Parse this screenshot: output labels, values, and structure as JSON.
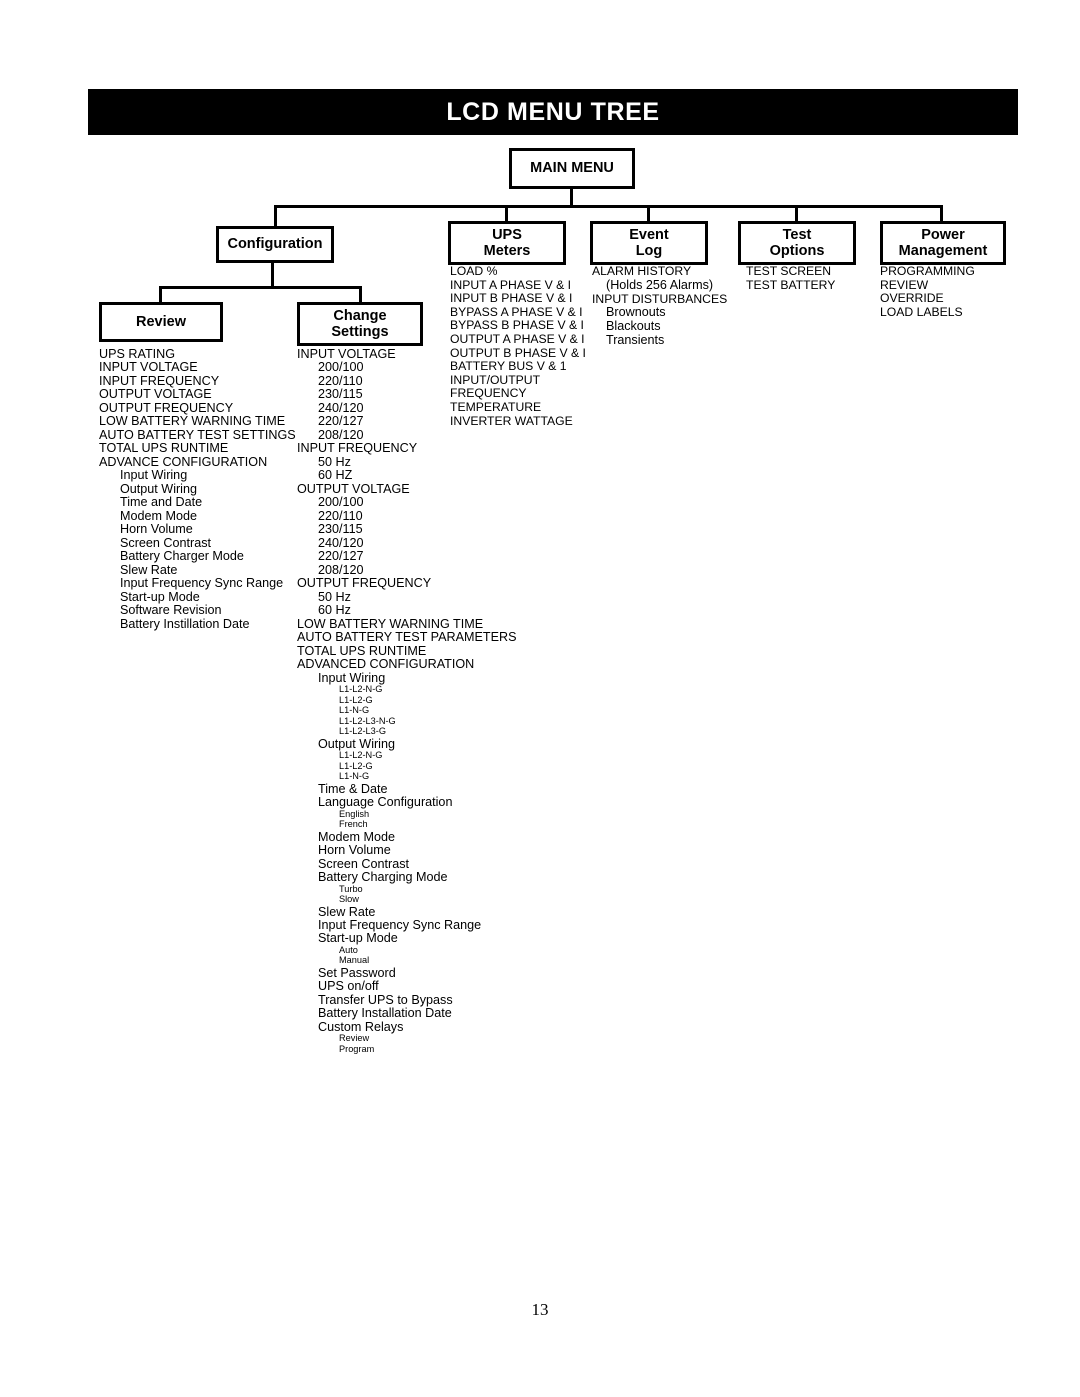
{
  "banner": {
    "title": "LCD MENU TREE",
    "background_color": "#000000",
    "text_color": "#FFFFFF"
  },
  "page_number": "13",
  "tree": {
    "root": {
      "label_line1": "MAIN MENU",
      "label_line2": ""
    },
    "top_level": [
      {
        "label_line1": "Configuration",
        "label_line2": ""
      },
      {
        "label_line1": "UPS",
        "label_line2": "Meters"
      },
      {
        "label_line1": "Event",
        "label_line2": "Log"
      },
      {
        "label_line1": "Test",
        "label_line2": "Options"
      },
      {
        "label_line1": "Power",
        "label_line2": "Management"
      }
    ],
    "configuration_children": [
      {
        "label_line1": "Review",
        "label_line2": ""
      },
      {
        "label_line1": "Change",
        "label_line2": "Settings"
      }
    ]
  },
  "lists": {
    "review": [
      {
        "level": 0,
        "text": "UPS RATING"
      },
      {
        "level": 0,
        "text": "INPUT VOLTAGE"
      },
      {
        "level": 0,
        "text": "INPUT FREQUENCY"
      },
      {
        "level": 0,
        "text": "OUTPUT VOLTAGE"
      },
      {
        "level": 0,
        "text": "OUTPUT FREQUENCY"
      },
      {
        "level": 0,
        "text": "LOW BATTERY WARNING TIME"
      },
      {
        "level": 0,
        "text": "AUTO BATTERY TEST SETTINGS"
      },
      {
        "level": 0,
        "text": "TOTAL UPS RUNTIME"
      },
      {
        "level": 0,
        "text": "ADVANCE CONFIGURATION"
      },
      {
        "level": 1,
        "text": "Input Wiring"
      },
      {
        "level": 1,
        "text": "Output Wiring"
      },
      {
        "level": 1,
        "text": "Time and Date"
      },
      {
        "level": 1,
        "text": "Modem Mode"
      },
      {
        "level": 1,
        "text": "Horn Volume"
      },
      {
        "level": 1,
        "text": "Screen Contrast"
      },
      {
        "level": 1,
        "text": "Battery Charger Mode"
      },
      {
        "level": 1,
        "text": "Slew Rate"
      },
      {
        "level": 1,
        "text": "Input Frequency Sync Range"
      },
      {
        "level": 1,
        "text": "Start-up Mode"
      },
      {
        "level": 1,
        "text": "Software Revision"
      },
      {
        "level": 1,
        "text": "Battery Instillation Date"
      }
    ],
    "change_settings": [
      {
        "level": 0,
        "text": "INPUT VOLTAGE"
      },
      {
        "level": 1,
        "text": "200/100"
      },
      {
        "level": 1,
        "text": "220/110"
      },
      {
        "level": 1,
        "text": "230/115"
      },
      {
        "level": 1,
        "text": "240/120"
      },
      {
        "level": 1,
        "text": "220/127"
      },
      {
        "level": 1,
        "text": "208/120"
      },
      {
        "level": 0,
        "text": "INPUT FREQUENCY"
      },
      {
        "level": 1,
        "text": "50 Hz"
      },
      {
        "level": 1,
        "text": "60 HZ"
      },
      {
        "level": 0,
        "text": "OUTPUT VOLTAGE"
      },
      {
        "level": 1,
        "text": "200/100"
      },
      {
        "level": 1,
        "text": "220/110"
      },
      {
        "level": 1,
        "text": "230/115"
      },
      {
        "level": 1,
        "text": "240/120"
      },
      {
        "level": 1,
        "text": "220/127"
      },
      {
        "level": 1,
        "text": "208/120"
      },
      {
        "level": 0,
        "text": "OUTPUT FREQUENCY"
      },
      {
        "level": 1,
        "text": "50 Hz"
      },
      {
        "level": 1,
        "text": "60 Hz"
      },
      {
        "level": 0,
        "text": "LOW BATTERY WARNING TIME"
      },
      {
        "level": 0,
        "text": "AUTO BATTERY TEST PARAMETERS"
      },
      {
        "level": 0,
        "text": "TOTAL UPS RUNTIME"
      },
      {
        "level": 0,
        "text": "ADVANCED CONFIGURATION"
      },
      {
        "level": 1,
        "text": "Input Wiring"
      },
      {
        "level": 2,
        "text": "L1-L2-N-G"
      },
      {
        "level": 2,
        "text": "L1-L2-G"
      },
      {
        "level": 2,
        "text": "L1-N-G"
      },
      {
        "level": 2,
        "text": "L1-L2-L3-N-G"
      },
      {
        "level": 2,
        "text": "L1-L2-L3-G"
      },
      {
        "level": 1,
        "text": "Output Wiring"
      },
      {
        "level": 2,
        "text": "L1-L2-N-G"
      },
      {
        "level": 2,
        "text": "L1-L2-G"
      },
      {
        "level": 2,
        "text": "L1-N-G"
      },
      {
        "level": 1,
        "text": "Time & Date"
      },
      {
        "level": 1,
        "text": "Language Configuration"
      },
      {
        "level": 2,
        "text": "English"
      },
      {
        "level": 2,
        "text": "French"
      },
      {
        "level": 1,
        "text": "Modem Mode"
      },
      {
        "level": 1,
        "text": "Horn Volume"
      },
      {
        "level": 1,
        "text": "Screen Contrast"
      },
      {
        "level": 1,
        "text": "Battery Charging Mode"
      },
      {
        "level": 2,
        "text": "Turbo"
      },
      {
        "level": 2,
        "text": "Slow"
      },
      {
        "level": 1,
        "text": "Slew Rate"
      },
      {
        "level": 1,
        "text": "Input Frequency Sync Range"
      },
      {
        "level": 1,
        "text": "Start-up Mode"
      },
      {
        "level": 2,
        "text": "Auto"
      },
      {
        "level": 2,
        "text": "Manual"
      },
      {
        "level": 1,
        "text": "Set Password"
      },
      {
        "level": 1,
        "text": "UPS on/off"
      },
      {
        "level": 1,
        "text": "Transfer UPS to Bypass"
      },
      {
        "level": 1,
        "text": "Battery Installation Date"
      },
      {
        "level": 1,
        "text": "Custom Relays"
      },
      {
        "level": 2,
        "text": "Review"
      },
      {
        "level": 2,
        "text": "Program"
      }
    ],
    "ups_meters": [
      {
        "level": 0,
        "text": "LOAD %"
      },
      {
        "level": 0,
        "text": "INPUT A PHASE V & I"
      },
      {
        "level": 0,
        "text": "INPUT B PHASE V & I"
      },
      {
        "level": 0,
        "text": "BYPASS A PHASE V & I"
      },
      {
        "level": 0,
        "text": "BYPASS B PHASE V & I"
      },
      {
        "level": 0,
        "text": "OUTPUT A PHASE V & I"
      },
      {
        "level": 0,
        "text": "OUTPUT B PHASE V & I"
      },
      {
        "level": 0,
        "text": "BATTERY BUS V & 1"
      },
      {
        "level": 0,
        "text": "INPUT/OUTPUT"
      },
      {
        "level": 0,
        "text": "FREQUENCY"
      },
      {
        "level": 0,
        "text": "TEMPERATURE"
      },
      {
        "level": 0,
        "text": "INVERTER WATTAGE"
      }
    ],
    "event_log": [
      {
        "level": 0,
        "text": "ALARM HISTORY"
      },
      {
        "level": 1,
        "text": "(Holds 256 Alarms)"
      },
      {
        "level": 0,
        "text": "INPUT DISTURBANCES"
      },
      {
        "level": 1,
        "text": "Brownouts"
      },
      {
        "level": 1,
        "text": "Blackouts"
      },
      {
        "level": 1,
        "text": "Transients"
      }
    ],
    "test_options": [
      {
        "level": 0,
        "text": "TEST SCREEN"
      },
      {
        "level": 0,
        "text": "TEST BATTERY"
      }
    ],
    "power_management": [
      {
        "level": 0,
        "text": "PROGRAMMING"
      },
      {
        "level": 0,
        "text": "REVIEW"
      },
      {
        "level": 0,
        "text": "OVERRIDE"
      },
      {
        "level": 0,
        "text": "LOAD LABELS"
      }
    ]
  }
}
